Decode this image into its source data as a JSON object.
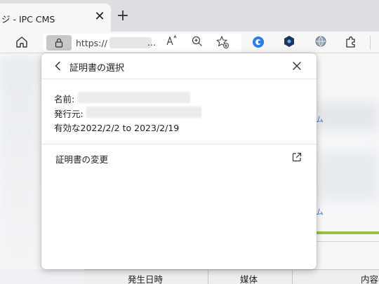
{
  "browser": {
    "tab_title": "ジ - IPC CMS",
    "tab_close": "✕",
    "new_tab": "+",
    "url_prefix": "https://",
    "url_ellipsis": "...",
    "icons": {
      "read_aloud": "Aᴬ",
      "read_aloud_name": "read-aloud-icon",
      "zoom_name": "zoom-icon",
      "favorite_name": "add-favorite-icon",
      "ext1_name": "extension-blue-c-icon",
      "ext2_name": "extension-shield-icon",
      "ext3_name": "extension-globe-icon",
      "extensions_name": "extensions-puzzle-icon"
    }
  },
  "popup": {
    "title": "証明書の選択",
    "name_label": "名前:",
    "issuer_label": "発行元:",
    "validity": "有効な2022/2/2 to 2023/2/19",
    "change_cert": "証明書の変更"
  },
  "page": {
    "link_glyph": "ム",
    "columns": [
      "発生日時",
      "媒体",
      "内容"
    ]
  },
  "colors": {
    "accent_green": "#9cbf3e",
    "popup_bg": "#ffffff"
  }
}
